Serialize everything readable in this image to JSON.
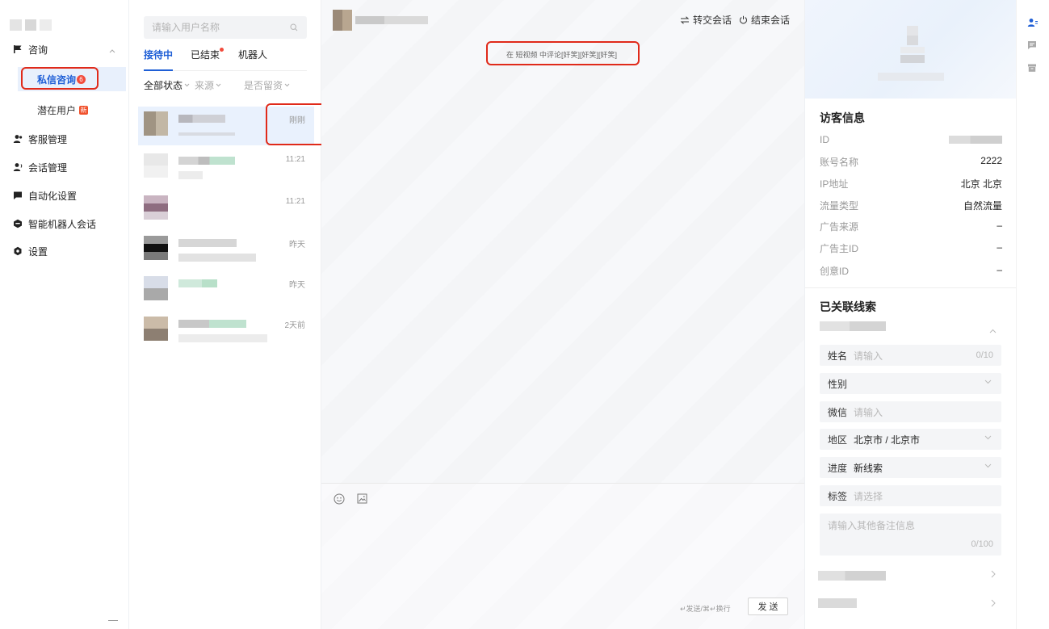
{
  "sidebar": {
    "nav": [
      {
        "label": "咨询",
        "icon": "flag-icon"
      },
      {
        "label": "客服管理",
        "icon": "people-icon"
      },
      {
        "label": "会话管理",
        "icon": "person-voice-icon"
      },
      {
        "label": "自动化设置",
        "icon": "chat-bubble-icon"
      },
      {
        "label": "智能机器人会话",
        "icon": "robot-icon"
      },
      {
        "label": "设置",
        "icon": "gear-icon"
      }
    ],
    "sub_items": [
      {
        "label": "私信咨询",
        "badge": "6",
        "active": true
      },
      {
        "label": "潜在用户",
        "badge": "新",
        "active": false
      }
    ]
  },
  "conversation_list": {
    "search_placeholder": "请输入用户名称",
    "tabs": [
      {
        "label": "接待中",
        "active": true
      },
      {
        "label": "已结束",
        "has_dot": true
      },
      {
        "label": "机器人"
      }
    ],
    "filters": [
      "全部状态",
      "来源",
      "是否留资"
    ],
    "items": [
      {
        "time": "刚刚",
        "selected": true
      },
      {
        "time": "11:21"
      },
      {
        "time": "11:21"
      },
      {
        "time": "昨天"
      },
      {
        "time": "昨天"
      },
      {
        "time": "2天前"
      }
    ]
  },
  "chat": {
    "transfer_label": "转交会话",
    "end_label": "结束会话",
    "system_message": "在 短视频 中评论[奸笑][奸笑][奸笑]",
    "send_hint": "↵发送/⌘↵换行",
    "send_label": "发 送"
  },
  "visitor": {
    "section_title": "访客信息",
    "rows": [
      {
        "label": "ID",
        "value": ""
      },
      {
        "label": "账号名称",
        "value": "2222"
      },
      {
        "label": "IP地址",
        "value": "北京 北京"
      },
      {
        "label": "流量类型",
        "value": "自然流量"
      },
      {
        "label": "广告来源",
        "value": "–"
      },
      {
        "label": "广告主ID",
        "value": "–"
      },
      {
        "label": "创意ID",
        "value": "–"
      }
    ]
  },
  "leads": {
    "section_title": "已关联线索",
    "name": {
      "label": "姓名",
      "placeholder": "请输入",
      "count": "0/10"
    },
    "gender": {
      "label": "性别"
    },
    "wechat": {
      "label": "微信",
      "placeholder": "请输入"
    },
    "region": {
      "label": "地区",
      "value": "北京市 / 北京市"
    },
    "progress": {
      "label": "进度",
      "value": "新线索"
    },
    "tags": {
      "label": "标签",
      "placeholder": "请选择"
    },
    "remark": {
      "placeholder": "请输入其他备注信息",
      "count": "0/100"
    }
  },
  "colors": {
    "accent": "#1f5fd6",
    "highlight_border": "#e02a1a",
    "badge_red": "#f24b3c"
  }
}
